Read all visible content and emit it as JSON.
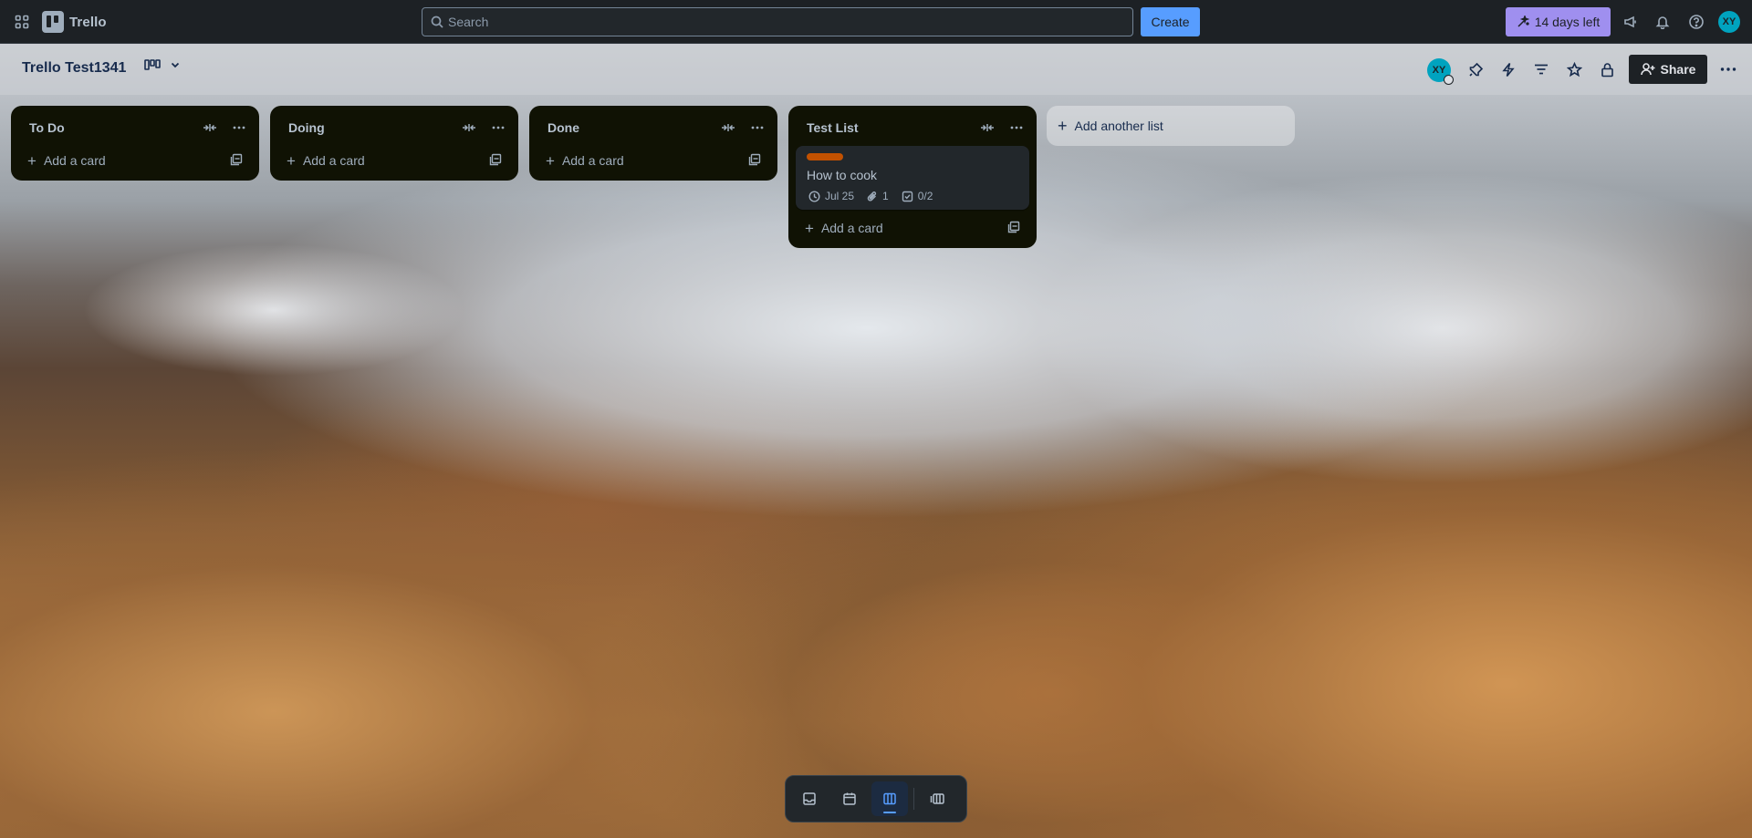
{
  "topbar": {
    "app_name": "Trello",
    "search_placeholder": "Search",
    "create_label": "Create",
    "trial_label": "14 days left",
    "user_initials": "XY"
  },
  "board": {
    "title": "Trello Test1341",
    "member_initials": "XY",
    "share_label": "Share"
  },
  "lists": [
    {
      "title": "To Do",
      "add_card_label": "Add a card"
    },
    {
      "title": "Doing",
      "add_card_label": "Add a card"
    },
    {
      "title": "Done",
      "add_card_label": "Add a card"
    },
    {
      "title": "Test List",
      "add_card_label": "Add a card",
      "cards": [
        {
          "title": "How to cook",
          "label_color": "#c25100",
          "due": "Jul 25",
          "attachments": "1",
          "checklist": "0/2"
        }
      ]
    }
  ],
  "add_list_label": "Add another list",
  "colors": {
    "nav_bg": "#1d2125",
    "create_blue": "#579dff",
    "trial_purple": "#9f8fef",
    "list_bg": "#101204",
    "card_bg": "#22272b",
    "avatar_teal": "#00a3bf"
  },
  "bottom_switcher": {
    "views": [
      "inbox",
      "planner",
      "board",
      "switch-boards"
    ],
    "active": "board"
  }
}
